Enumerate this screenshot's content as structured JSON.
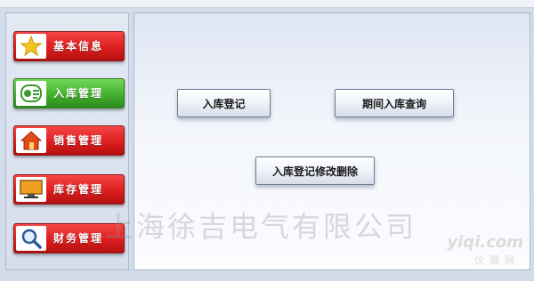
{
  "sidebar": {
    "items": [
      {
        "label": "基本信息",
        "icon": "star-icon",
        "state": "default"
      },
      {
        "label": "入库管理",
        "icon": "inbound-icon",
        "state": "active"
      },
      {
        "label": "销售管理",
        "icon": "home-icon",
        "state": "default"
      },
      {
        "label": "库存管理",
        "icon": "monitor-icon",
        "state": "default"
      },
      {
        "label": "财务管理",
        "icon": "magnifier-icon",
        "state": "default"
      }
    ]
  },
  "main": {
    "buttons": {
      "register": "入库登记",
      "period_query": "期间入库查询",
      "modify_delete": "入库登记修改删除"
    }
  },
  "watermark": {
    "company": "上海徐吉电气有限公司",
    "site": "yiqi.com",
    "site_cn": "仪器网"
  },
  "colors": {
    "nav_default": "#dc1f1f",
    "nav_active": "#43b02d",
    "panel_bg": "#f3f6fb"
  }
}
